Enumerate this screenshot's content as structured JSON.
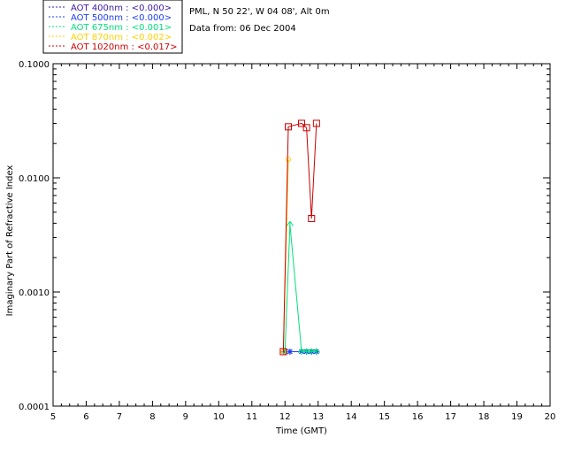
{
  "chart_data": {
    "type": "line",
    "title": "",
    "info_lines": [
      "PML, N 50 22', W 04 08', Alt 0m",
      "Data from: 06 Dec 2004"
    ],
    "xlabel": "Time (GMT)",
    "ylabel": "Imaginary Part of Refractive Index",
    "xlim": [
      5,
      20
    ],
    "ylim": [
      0.0001,
      0.1
    ],
    "yscale": "log",
    "x_ticks": [
      "5",
      "6",
      "7",
      "8",
      "9",
      "10",
      "11",
      "12",
      "13",
      "14",
      "15",
      "16",
      "17",
      "18",
      "19",
      "20"
    ],
    "y_ticks": [
      "0.0001",
      "0.0010",
      "0.0100",
      "0.1000"
    ],
    "grid": false,
    "legend_position": "top-left, above plot",
    "series": [
      {
        "name": "AOT  400nm : <0.000>",
        "color": "#3a1aa8",
        "marker": "star",
        "x": [
          12.0,
          12.15,
          12.5,
          12.65,
          12.8,
          12.95
        ],
        "y": [
          0.0003,
          0.0003,
          0.0003,
          0.0003,
          0.0003,
          0.0003
        ]
      },
      {
        "name": "AOT  500nm : <0.000>",
        "color": "#1a3cff",
        "marker": "star",
        "x": [
          12.0,
          12.15,
          12.5,
          12.65,
          12.8,
          12.95
        ],
        "y": [
          0.0003,
          0.0003,
          0.0003,
          0.0003,
          0.0003,
          0.0003
        ]
      },
      {
        "name": "AOT  675nm : <0.001>",
        "color": "#00e07a",
        "marker": "arrow",
        "x": [
          12.0,
          12.15,
          12.5,
          12.65,
          12.8,
          12.95
        ],
        "y": [
          0.0003,
          0.0039,
          0.0003,
          0.0003,
          0.0003,
          0.0003
        ]
      },
      {
        "name": "AOT  870nm : <0.002>",
        "color": "#ffd000",
        "marker": "circle",
        "x": [
          11.95,
          12.1
        ],
        "y": [
          0.0003,
          0.0145
        ]
      },
      {
        "name": "AOT 1020nm : <0.017>",
        "color": "#cc0000",
        "marker": "square",
        "x": [
          11.95,
          12.1,
          12.5,
          12.65,
          12.8,
          12.95
        ],
        "y": [
          0.0003,
          0.028,
          0.03,
          0.0275,
          0.0044,
          0.03
        ]
      }
    ]
  }
}
